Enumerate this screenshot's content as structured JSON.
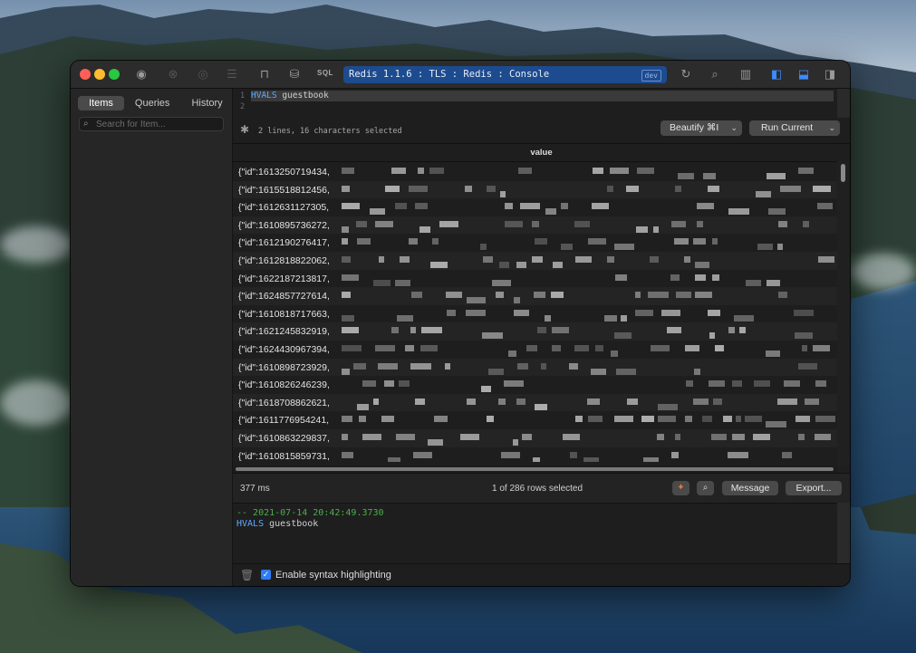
{
  "window": {
    "title": "Redis 1.1.6 : TLS :  Redis : Console",
    "env_badge": "dev",
    "toolbar_sql_label": "SQL"
  },
  "sidebar": {
    "tabs": [
      "Items",
      "Queries",
      "History"
    ],
    "active_tab": "Items",
    "search_placeholder": "Search for Item...",
    "add_label": "+",
    "add_menu_glyph": "⌄"
  },
  "editor": {
    "line_numbers": [
      "1",
      "2"
    ],
    "command": "HVALS",
    "argument": " guestbook",
    "selection_info": "2 lines, 16 characters selected",
    "beautify_label": "Beautify ⌘I",
    "run_label": "Run Current"
  },
  "results": {
    "column": "value",
    "rows": [
      "{\"id\":1613250719434,",
      "{\"id\":1615518812456,",
      "{\"id\":1612631127305,",
      "{\"id\":1610895736272,",
      "{\"id\":1612190276417,",
      "{\"id\":1612818822062,",
      "{\"id\":1622187213817,",
      "{\"id\":1624857727614,",
      "{\"id\":1610818717663,",
      "{\"id\":1621245832919,",
      "{\"id\":1624430967394,",
      "{\"id\":1610898723929,",
      "{\"id\":1610826246239,",
      "{\"id\":1618708862621,",
      "{\"id\":1611776954241,",
      "{\"id\":1610863229837,",
      "{\"id\":1610815859731,"
    ],
    "elapsed": "377 ms",
    "rows_selected": "1 of 286 rows selected",
    "message_label": "Message",
    "export_label": "Export..."
  },
  "console": {
    "timestamp": "-- 2021-07-14 20:42:49.3730",
    "command": "HVALS",
    "argument": " guestbook"
  },
  "footer": {
    "syntax_highlight_label": "Enable syntax highlighting",
    "syntax_highlight_checked": true
  },
  "colors": {
    "title_pill": "#1d4b8f",
    "accent_blue": "#2f7cf6",
    "console_timestamp": "#4cae4c",
    "keyword": "#5fa8ff"
  },
  "icons": [
    "plugin-icon",
    "stop-icon",
    "eye-icon",
    "list-icon",
    "unlock-icon",
    "database-icon",
    "refresh-icon",
    "search-icon",
    "columns-icon",
    "left-panel-icon",
    "bottom-panel-icon",
    "right-panel-icon",
    "gear-icon",
    "pin-icon",
    "trash-icon"
  ]
}
